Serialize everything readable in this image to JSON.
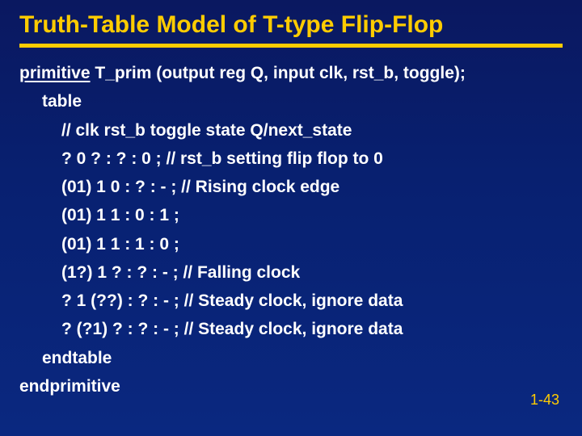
{
  "title": "Truth-Table Model of T-type Flip-Flop",
  "decl_kw": "primitive",
  "decl_rest": " T_prim (output reg Q, input clk, rst_b, toggle);",
  "table_kw": "table",
  "rows": {
    "r0": "// clk rst_b toggle state Q/next_state",
    "r1": "? 0 ? : ? : 0 ; // rst_b setting flip flop to 0",
    "r2": "(01) 1 0 : ? : - ; // Rising clock edge",
    "r3": "(01) 1 1 : 0 : 1 ;",
    "r4": "(01) 1 1 : 1 : 0 ;",
    "r5": "(1?) 1 ? : ? : - ; // Falling clock",
    "r6": "? 1 (??) : ? : - ; // Steady clock, ignore data",
    "r7": "? (?1) ? : ? : - ; // Steady clock, ignore data"
  },
  "endtable": "endtable",
  "endprimitive": "endprimitive",
  "pagenum": "1-43"
}
